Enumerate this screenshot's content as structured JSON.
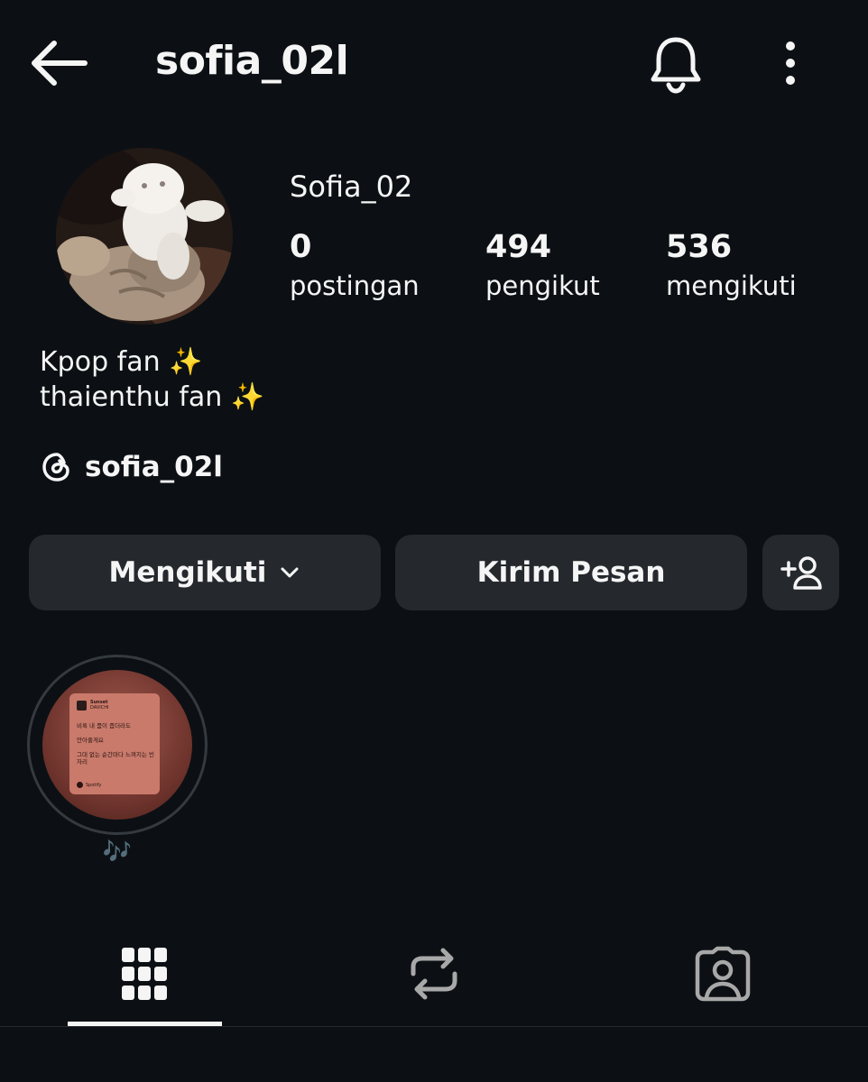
{
  "header": {
    "username": "sofia_02l",
    "back_icon": "arrow-left-icon",
    "notification_icon": "bell-icon",
    "more_icon": "more-vertical-icon"
  },
  "profile": {
    "display_name": "Sofia_02",
    "avatar": "cat-photo-avatar",
    "stats": [
      {
        "value": "0",
        "label": "postingan"
      },
      {
        "value": "494",
        "label": "pengikut"
      },
      {
        "value": "536",
        "label": "mengikuti"
      }
    ],
    "bio": [
      "Kpop fan ✨",
      "thaienthu fan ✨"
    ],
    "threads_handle": "sofia_02l",
    "threads_icon": "threads-icon"
  },
  "actions": {
    "following_label": "Mengikuti",
    "message_label": "Kirim Pesan",
    "suggest_icon": "add-person-icon"
  },
  "highlights": [
    {
      "label": "🎶",
      "card": {
        "song": "Sunset",
        "artist": "DAVICHI",
        "lines": [
          "비록 내 품이 좁더라도",
          "안아줄게요",
          "그대 없는 순간마다 느껴지는 빈자리"
        ],
        "source": "Spotify"
      }
    }
  ],
  "tabs": [
    {
      "name": "posts",
      "icon": "grid-icon",
      "active": true
    },
    {
      "name": "reposts",
      "icon": "repost-icon",
      "active": false
    },
    {
      "name": "tagged",
      "icon": "tagged-person-icon",
      "active": false
    }
  ],
  "colors": {
    "background": "#0c1014",
    "button_bg": "#25292e",
    "text": "#f5f5f5",
    "muted_icon": "#a8a8a8"
  }
}
